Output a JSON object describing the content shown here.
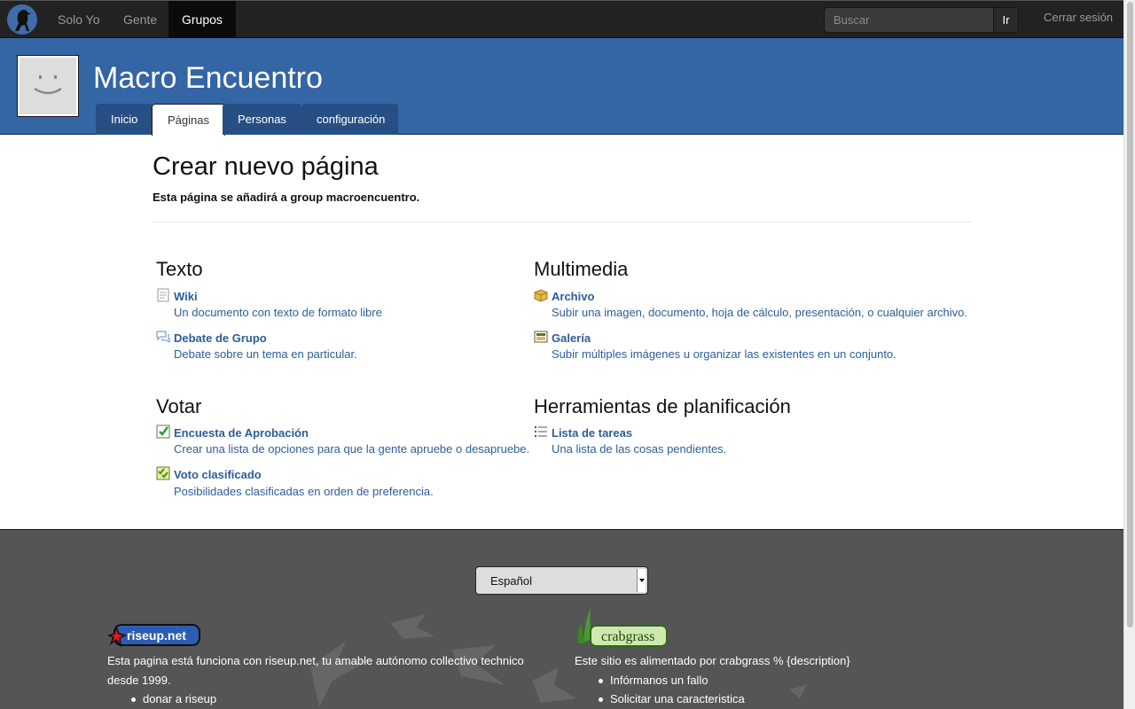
{
  "nav": {
    "links": [
      {
        "label": "Solo Yo",
        "active": false
      },
      {
        "label": "Gente",
        "active": false
      },
      {
        "label": "Grupos",
        "active": true
      }
    ],
    "search_placeholder": "Buscar",
    "search_button": "Ir",
    "logout": "Cerrar sesión"
  },
  "group": {
    "title": "Macro Encuentro",
    "tabs": [
      {
        "label": "Inicio",
        "active": false
      },
      {
        "label": "Páginas",
        "active": true
      },
      {
        "label": "Personas",
        "active": false
      },
      {
        "label": "configuración",
        "active": false
      }
    ]
  },
  "main": {
    "heading": "Crear nuevo página",
    "subtitle": "Esta página se añadirá a group macroencuentro.",
    "sections": [
      {
        "title": "Texto",
        "items": [
          {
            "icon": "wiki-page-icon",
            "title": "Wiki",
            "desc": "Un documento con texto de formato libre"
          },
          {
            "icon": "discussion-icon",
            "title": "Debate de Grupo",
            "desc": "Debate sobre un tema en particular."
          }
        ]
      },
      {
        "title": "Multimedia",
        "items": [
          {
            "icon": "package-icon",
            "title": "Archivo",
            "desc": "Subir una imagen, documento, hoja de cálculo, presentación, o cualquier archivo."
          },
          {
            "icon": "gallery-icon",
            "title": "Galería",
            "desc": "Subir múltiples imágenes u organizar las existentes en un conjunto."
          }
        ]
      },
      {
        "title": "Votar",
        "items": [
          {
            "icon": "checkbox-icon",
            "title": "Encuesta de Aprobación",
            "desc": "Crear una lista de opciones para que la gente apruebe o desapruebe."
          },
          {
            "icon": "ranked-vote-icon",
            "title": "Voto clasificado",
            "desc": "Posibilidades clasificadas en orden de preferencia."
          }
        ]
      },
      {
        "title": "Herramientas de planificación",
        "items": [
          {
            "icon": "task-list-icon",
            "title": "Lista de tareas",
            "desc": "Una lista de las cosas pendientes."
          }
        ]
      }
    ]
  },
  "footer": {
    "language": "Español",
    "riseup_badge": "riseup.net",
    "riseup_text_before": "Esta pagina está funciona con ",
    "riseup_link": "riseup.net",
    "riseup_text_after": ", tu amable autónomo collectivo technico desde 1999.",
    "riseup_items": [
      "donar a riseup"
    ],
    "crabgrass_badge": "crabgrass",
    "crabgrass_text_before": "Este sitio es alimentado por ",
    "crabgrass_link": "crabgrass",
    "crabgrass_text_after": " % {description}",
    "crabgrass_items": [
      "Infórmanos un fallo",
      "Solicitar una caracteristica"
    ]
  },
  "colors": {
    "navbar": "#222222",
    "banner": "#3465a4",
    "link": "#2c5d9a",
    "footer": "#555555"
  }
}
